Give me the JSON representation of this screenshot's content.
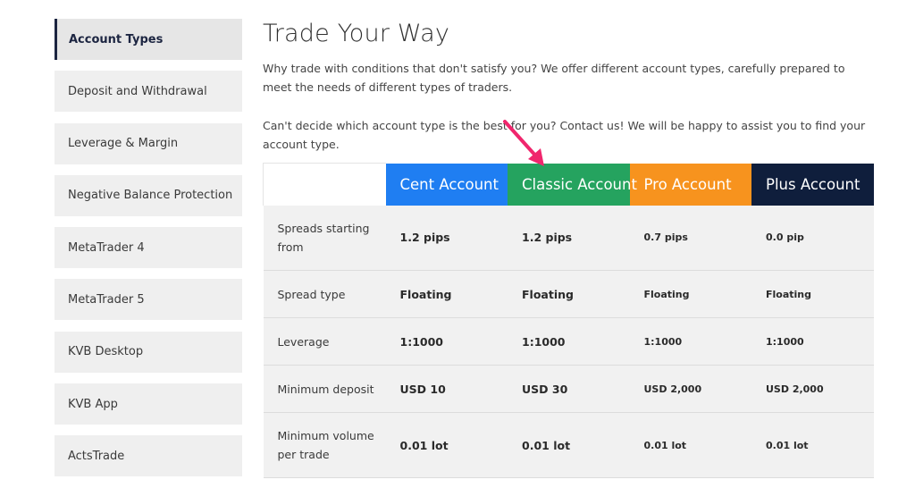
{
  "sidebar": {
    "items": [
      {
        "label": "Account Types",
        "active": true
      },
      {
        "label": "Deposit and Withdrawal"
      },
      {
        "label": "Leverage & Margin"
      },
      {
        "label": "Negative Balance Protection"
      },
      {
        "label": "MetaTrader 4"
      },
      {
        "label": "MetaTrader 5"
      },
      {
        "label": "KVB Desktop"
      },
      {
        "label": "KVB App"
      },
      {
        "label": "ActsTrade"
      }
    ]
  },
  "main": {
    "title": "Trade Your Way",
    "intro": "Why trade with conditions that don't satisfy you? We offer different account types, carefully prepared to meet the needs of different types of traders.",
    "contact": "Can't decide which account type is the best for you? Contact us! We will be happy to assist you to find your account type."
  },
  "colors": {
    "cent": "#1f7ef2",
    "classic": "#25a35f",
    "pro": "#f7931e",
    "plus": "#0f1e3c",
    "arrow": "#f0266d"
  },
  "table": {
    "headers": [
      "Cent Account",
      "Classic Account",
      "Pro Account",
      "Plus Account"
    ],
    "rows": [
      {
        "label": "Spreads starting from",
        "values": [
          "1.2 pips",
          "1.2 pips",
          "0.7 pips",
          "0.0 pip"
        ]
      },
      {
        "label": "Spread type",
        "values": [
          "Floating",
          "Floating",
          "Floating",
          "Floating"
        ]
      },
      {
        "label": "Leverage",
        "values": [
          "1:1000",
          "1:1000",
          "1:1000",
          "1:1000"
        ]
      },
      {
        "label": "Minimum deposit",
        "values": [
          "USD 10",
          "USD 30",
          "USD 2,000",
          "USD 2,000"
        ]
      },
      {
        "label": "Minimum volume per trade",
        "values": [
          "0.01 lot",
          "0.01 lot",
          "0.01 lot",
          "0.01 lot"
        ]
      }
    ]
  }
}
